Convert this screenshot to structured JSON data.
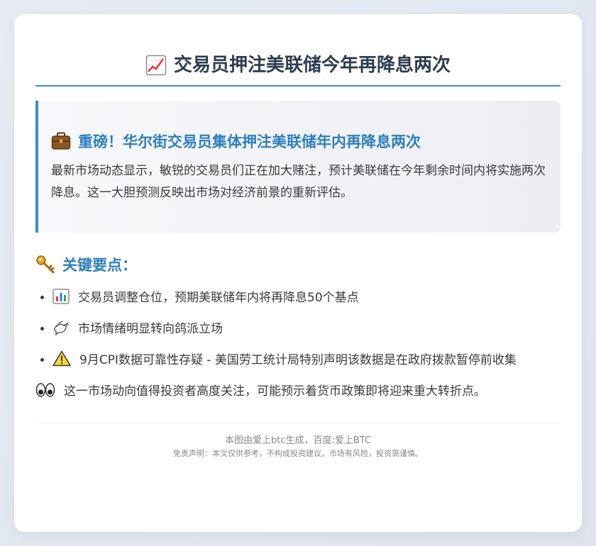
{
  "title": "交易员押注美联储今年再降息两次",
  "title_icon": "chart-increasing-icon",
  "highlight": {
    "icon": "briefcase-icon",
    "heading": "重磅！华尔街交易员集体押注美联储年内再降息两次",
    "body": "最新市场动态显示，敏锐的交易员们正在加大赌注，预计美联储在今年剩余时间内将实施两次降息。这一大胆预测反映出市场对经济前景的重新评估。"
  },
  "key_points": {
    "icon": "key-icon",
    "heading": "关键要点：",
    "items": [
      {
        "icon": "bar-chart-icon",
        "text": "交易员调整仓位，预期美联储年内将再降息50个基点"
      },
      {
        "icon": "dove-icon",
        "text": "市场情绪明显转向鸽派立场"
      },
      {
        "icon": "warning-icon",
        "text": "9月CPI数据可靠性存疑 - 美国劳工统计局特别声明该数据是在政府拨款暂停前收集"
      }
    ]
  },
  "note": {
    "icon": "eyes-icon",
    "text": "这一市场动向值得投资者高度关注，可能预示着货币政策即将迎来重大转折点。"
  },
  "footer": {
    "line1": "本图由爱上btc生成，百度:爱上BTC",
    "line2": "免责声明：本文仅供参考，不构成投资建议。市场有风险，投资需谨慎。"
  },
  "colors": {
    "accent": "#3a8dc9",
    "heading_blue": "#2e7fbf",
    "title_dark": "#2c3e50"
  }
}
